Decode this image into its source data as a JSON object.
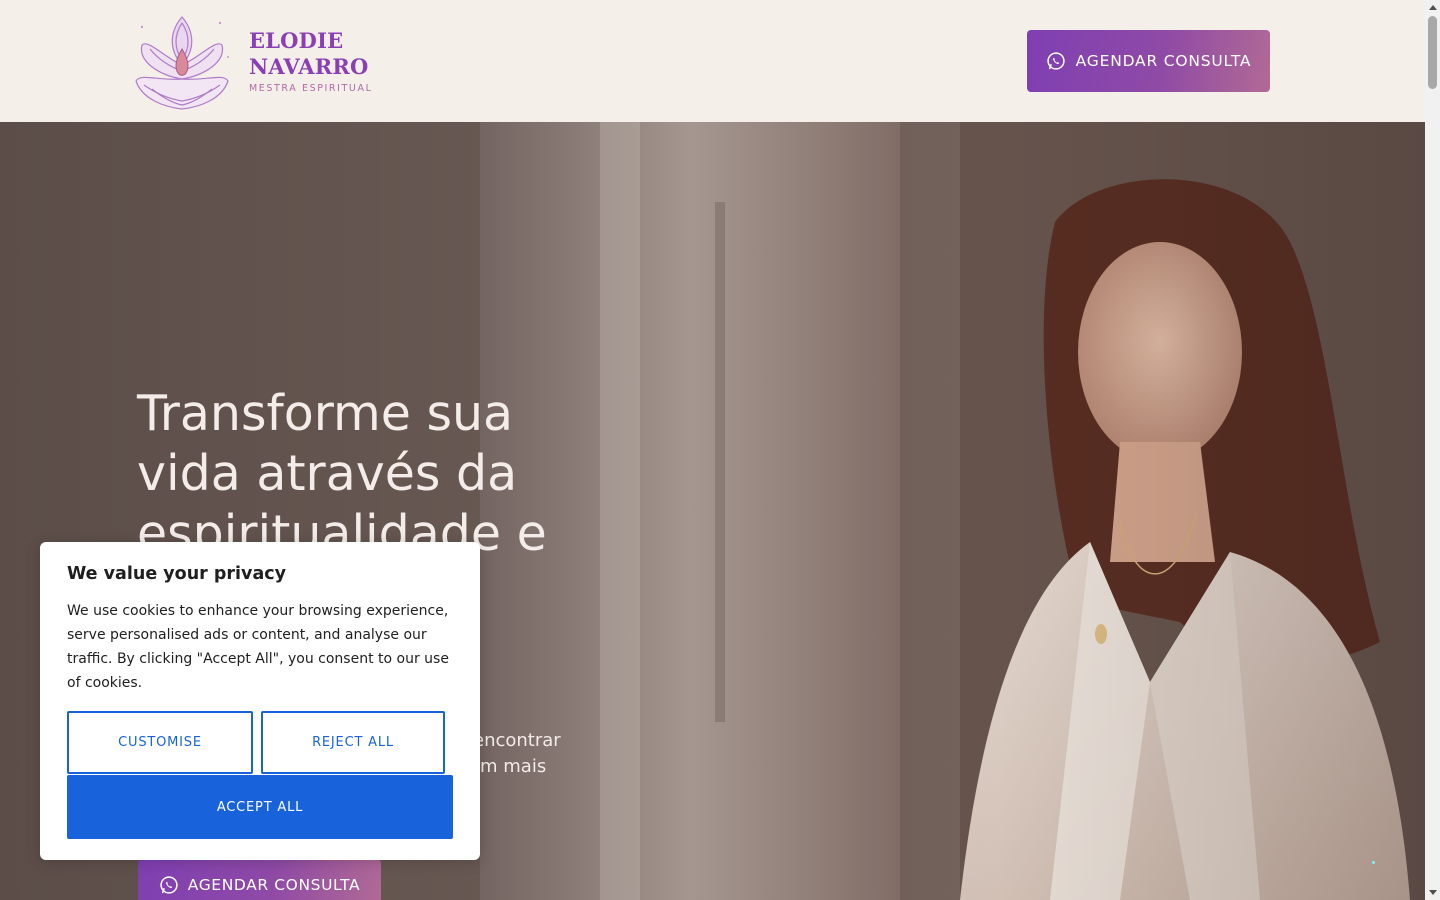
{
  "header": {
    "logo": {
      "name_line1": "ELODIE",
      "name_line2": "NAVARRO",
      "subtitle": "MESTRA ESPIRITUAL"
    },
    "cta_label": "AGENDAR CONSULTA",
    "cta_icon": "whatsapp-icon"
  },
  "hero": {
    "title": "Transforme sua vida através da espiritualidade e",
    "subtitle_visible_fragments": [
      "encontrar",
      "om mais"
    ],
    "cta_label": "AGENDAR CONSULTA",
    "cta_icon": "whatsapp-icon"
  },
  "cookie_banner": {
    "title": "We value your privacy",
    "text": "We use cookies to enhance your browsing experience, serve personalised ads or content, and analyse our traffic. By clicking \"Accept All\", you consent to our use of cookies.",
    "customise_label": "CUSTOMISE",
    "reject_label": "REJECT ALL",
    "accept_label": "ACCEPT ALL"
  },
  "colors": {
    "brand_purple": "#7f3fb2",
    "brand_pink": "#b16a95",
    "header_bg": "#f5efea",
    "cookie_blue": "#1863dc"
  }
}
